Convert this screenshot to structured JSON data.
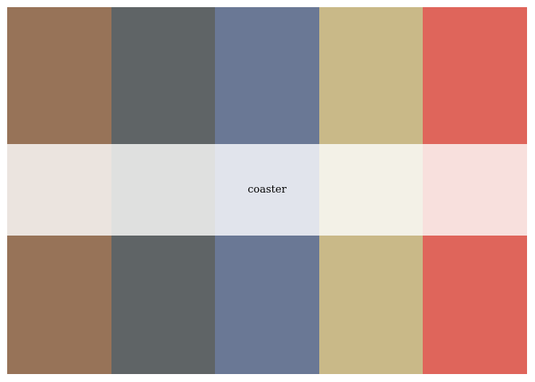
{
  "palette": {
    "label": "coaster",
    "swatches": [
      {
        "color": "#977358",
        "tint": "#ebe4df"
      },
      {
        "color": "#5f6466",
        "tint": "#dfe0df"
      },
      {
        "color": "#6a7895",
        "tint": "#e1e4ec"
      },
      {
        "color": "#c9b988",
        "tint": "#f3f1e7"
      },
      {
        "color": "#df655b",
        "tint": "#f8e0dd"
      }
    ]
  }
}
